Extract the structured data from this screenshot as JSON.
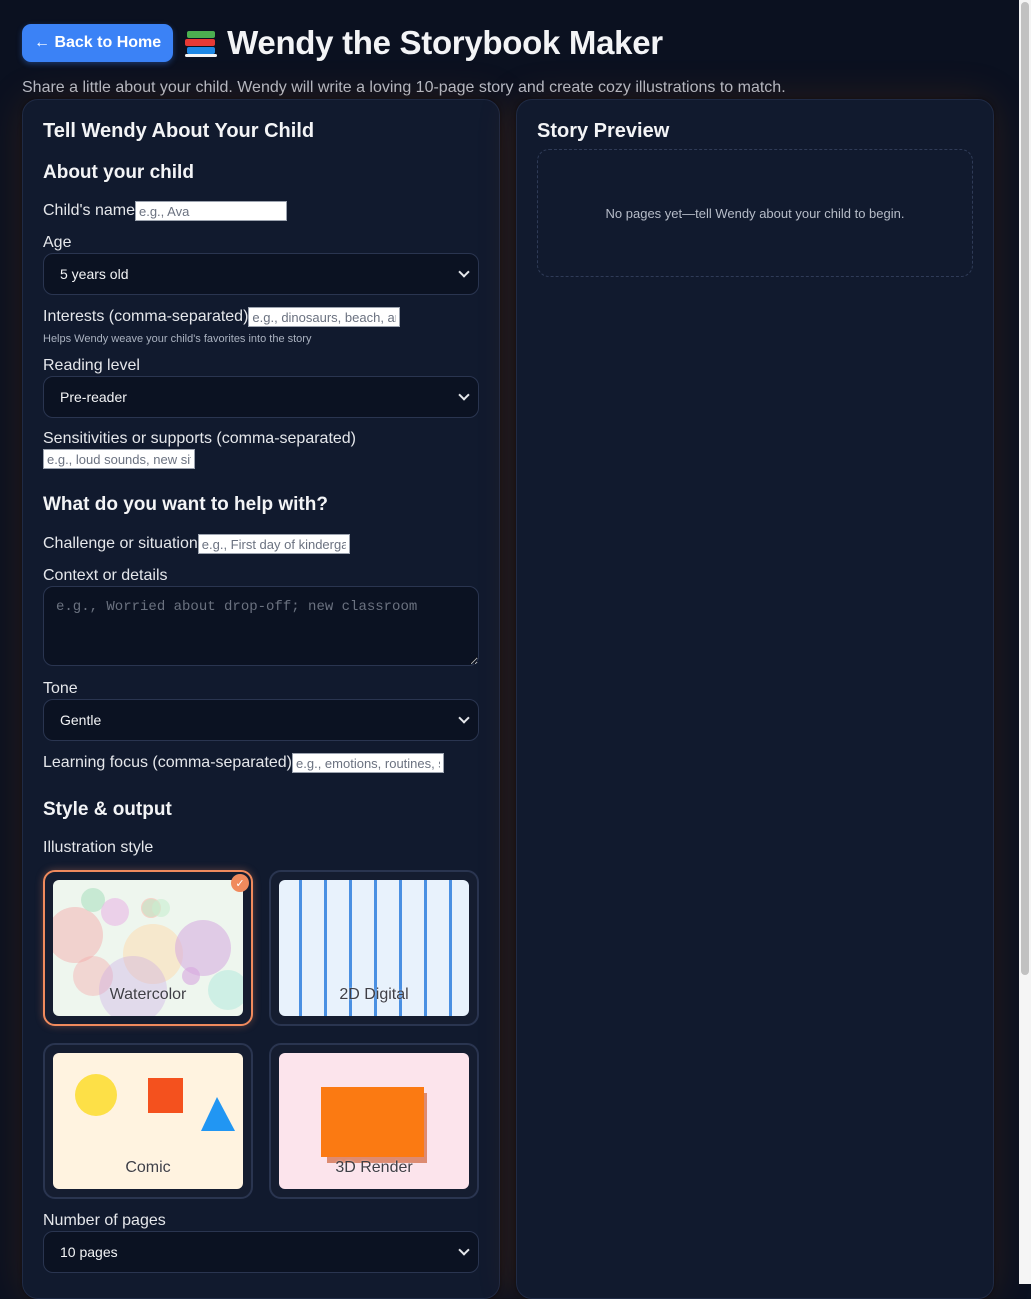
{
  "header": {
    "back_label": "← Back to Home",
    "title": "Wendy the Storybook Maker",
    "subtitle": "Share a little about your child. Wendy will write a loving 10-page story and create cozy illustrations to match."
  },
  "form": {
    "panel_title": "Tell Wendy About Your Child",
    "about_heading": "About your child",
    "name_label": "Child's name",
    "name_placeholder": "e.g., Ava",
    "age_label": "Age",
    "age_value": "5 years old",
    "interests_label": "Interests (comma-separated)",
    "interests_placeholder": "e.g., dinosaurs, beach, art",
    "interests_hint": "Helps Wendy weave your child's favorites into the story",
    "reading_label": "Reading level",
    "reading_value": "Pre-reader",
    "sensitivities_label": "Sensitivities or supports (comma-separated)",
    "sensitivities_placeholder": "e.g., loud sounds, new situations",
    "help_heading": "What do you want to help with?",
    "challenge_label": "Challenge or situation",
    "challenge_placeholder": "e.g., First day of kindergarten",
    "context_label": "Context or details",
    "context_placeholder": "e.g., Worried about drop-off; new classroom",
    "tone_label": "Tone",
    "tone_value": "Gentle",
    "learning_label": "Learning focus (comma-separated)",
    "learning_placeholder": "e.g., emotions, routines, sharing",
    "style_heading": "Style & output",
    "illustration_label": "Illustration style",
    "styles": [
      {
        "label": "Watercolor",
        "selected": true
      },
      {
        "label": "2D Digital",
        "selected": false
      },
      {
        "label": "Comic",
        "selected": false
      },
      {
        "label": "3D Render",
        "selected": false
      }
    ],
    "pages_label": "Number of pages",
    "pages_value": "10 pages"
  },
  "preview": {
    "title": "Story Preview",
    "empty_text": "No pages yet—tell Wendy about your child to begin."
  },
  "colors": {
    "accent": "#3b82f6",
    "selected_border": "#f08a5d",
    "background": "#0b1120",
    "panel": "#111a2e"
  }
}
